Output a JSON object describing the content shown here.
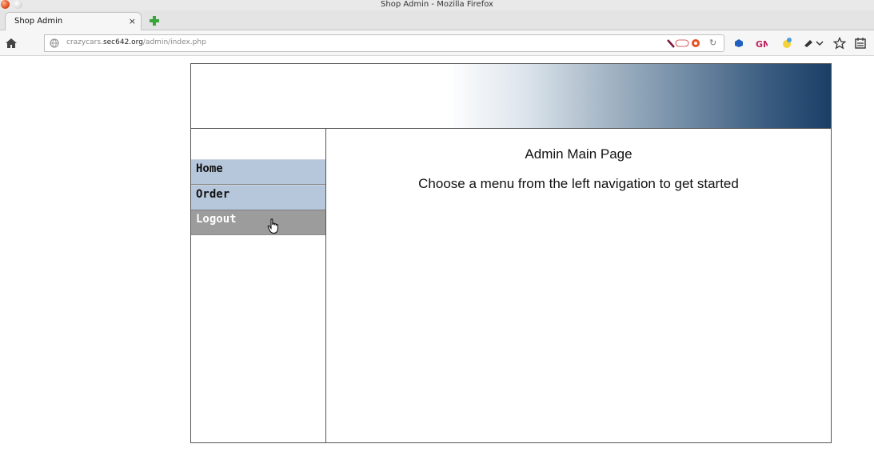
{
  "window": {
    "title": "Shop Admin - Mozilla Firefox"
  },
  "tabs": [
    {
      "label": "Shop Admin",
      "close": "×"
    }
  ],
  "addressbar": {
    "url_prefix": "crazycars.",
    "url_domain": "sec642.org",
    "url_path": "/admin/index.php"
  },
  "sidebar": {
    "items": [
      {
        "label": "Home"
      },
      {
        "label": "Order"
      },
      {
        "label": "Logout"
      }
    ]
  },
  "main": {
    "title": "Admin Main Page",
    "subtitle": "Choose a menu from the left navigation to get started"
  },
  "colors": {
    "menu_bg": "#b6c7db",
    "menu_hover_bg": "#9c9c9c",
    "header_gradient_end": "#1a3e66"
  }
}
